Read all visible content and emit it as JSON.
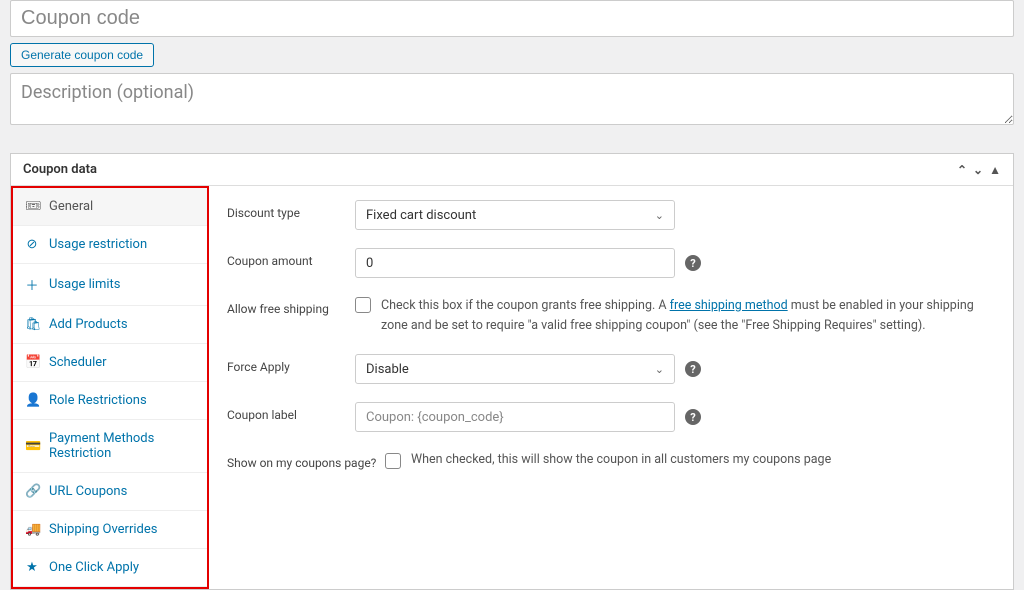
{
  "coupon_code": {
    "placeholder": "Coupon code"
  },
  "generate_button": "Generate coupon code",
  "description": {
    "placeholder": "Description (optional)"
  },
  "panel_title": "Coupon data",
  "tabs": {
    "general": "General",
    "usage_restriction": "Usage restriction",
    "usage_limits": "Usage limits",
    "add_products": "Add Products",
    "scheduler": "Scheduler",
    "role_restrictions": "Role Restrictions",
    "payment_methods": "Payment Methods Restriction",
    "url_coupons": "URL Coupons",
    "shipping_overrides": "Shipping Overrides",
    "one_click_apply": "One Click Apply"
  },
  "fields": {
    "discount_type": {
      "label": "Discount type",
      "value": "Fixed cart discount"
    },
    "coupon_amount": {
      "label": "Coupon amount",
      "value": "0"
    },
    "free_shipping": {
      "label": "Allow free shipping",
      "text_before": "Check this box if the coupon grants free shipping. A ",
      "link_text": "free shipping method",
      "text_after": " must be enabled in your shipping zone and be set to require \"a valid free shipping coupon\" (see the \"Free Shipping Requires\" setting)."
    },
    "force_apply": {
      "label": "Force Apply",
      "value": "Disable"
    },
    "coupon_label": {
      "label": "Coupon label",
      "placeholder": "Coupon: {coupon_code}"
    },
    "show_on_page": {
      "label": "Show on my coupons page?",
      "text": "When checked, this will show the coupon in all customers my coupons page"
    }
  }
}
